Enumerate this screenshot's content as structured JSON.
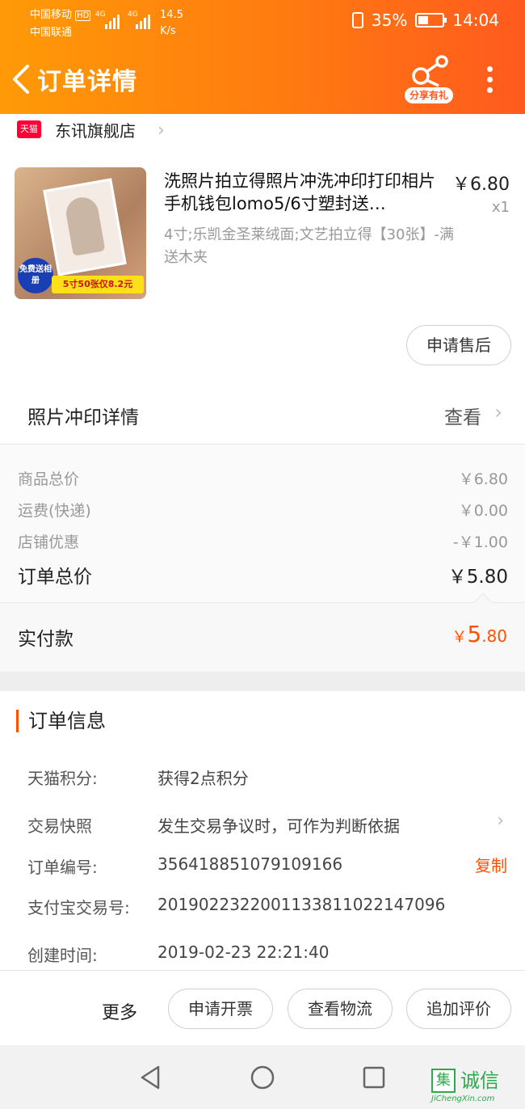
{
  "status_bar": {
    "carrier1": "中国移动",
    "hd": "HD",
    "carrier2": "中国联通",
    "net1": "4G",
    "net2": "4G",
    "speed": "14.5",
    "speed_unit": "K/s",
    "battery": "35%",
    "time": "14:04"
  },
  "header": {
    "title": "订单详情",
    "share_label": "分享有礼"
  },
  "shop": {
    "badge": "天猫",
    "name": "东讯旗舰店"
  },
  "product": {
    "title": "洗照片拍立得照片冲洗冲印打印相片手机钱包lomo5/6寸塑封送…",
    "price": "￥6.80",
    "quantity": "x1",
    "spec": "4寸;乐凯金圣莱绒面;文艺拍立得【30张】-满送木夹",
    "thumb_badge_free": "免费送相册",
    "thumb_badge_price": "5寸50张仅8.2元",
    "after_sale_button": "申请售后"
  },
  "print_details": {
    "label": "照片冲印详情",
    "view": "查看"
  },
  "summary": {
    "rows": [
      {
        "label": "商品总价",
        "value": "￥6.80"
      },
      {
        "label": "运费(快递)",
        "value": "￥0.00"
      },
      {
        "label": "店铺优惠",
        "value": "-￥1.00"
      }
    ],
    "total_label": "订单总价",
    "total_value": "￥5.80",
    "paid_label": "实付款",
    "paid_currency": "￥",
    "paid_int": "5",
    "paid_dec": ".80"
  },
  "order_info": {
    "heading": "订单信息",
    "rows": [
      {
        "key": "天猫积分:",
        "value": "获得2点积分"
      },
      {
        "key": "交易快照",
        "value": "发生交易争议时，可作为判断依据"
      },
      {
        "key": "订单编号:",
        "value": "356418851079109166"
      },
      {
        "key": "支付宝交易号:",
        "value": "2019022322001133811022147096"
      },
      {
        "key": "创建时间:",
        "value": "2019-02-23 22:21:40"
      }
    ],
    "copy_label": "复制"
  },
  "actions": {
    "more": "更多",
    "invoice": "申请开票",
    "logistics": "查看物流",
    "review": "追加评价"
  },
  "watermark": {
    "logo_char": "集",
    "text": "诚信",
    "sub": "JiChengXin.com"
  },
  "colors": {
    "header_start": "#ff9a07",
    "header_end": "#ff5a1e",
    "accent": "#ff5000"
  }
}
